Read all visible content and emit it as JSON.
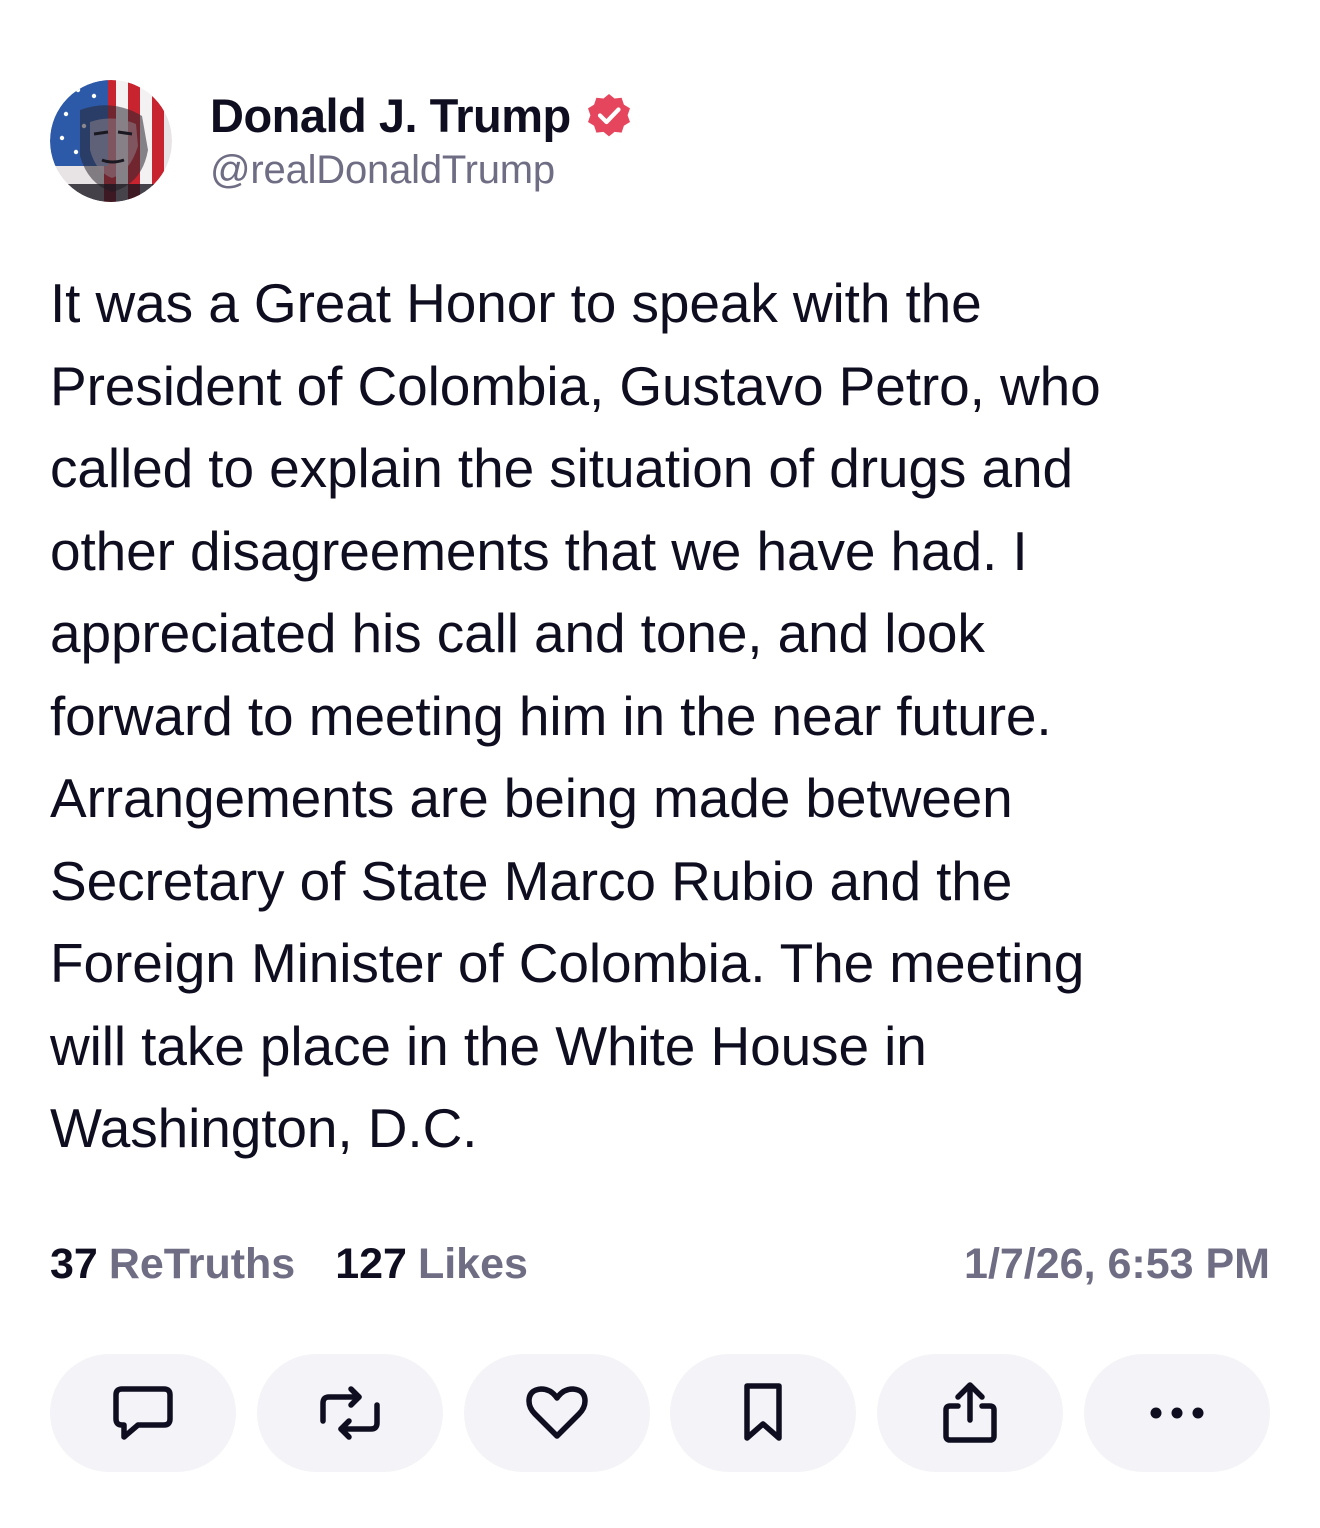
{
  "author": {
    "display_name": "Donald J. Trump",
    "handle": "@realDonaldTrump",
    "verified": true,
    "verified_color": "#e5465e"
  },
  "post": {
    "lines": [
      "It was a Great Honor to speak with the",
      "President of Colombia, Gustavo Petro, who",
      "called to explain the situation of drugs and",
      "other disagreements that we have had. I",
      "appreciated his call and tone, and look",
      "forward to meeting him in the near future.",
      "Arrangements are being made between",
      "Secretary of State Marco Rubio and the",
      "Foreign Minister of Colombia. The meeting",
      "will take place in the White House in",
      "Washington, D.C."
    ]
  },
  "stats": {
    "retruths_count": "37",
    "retruths_label": "ReTruths",
    "likes_count": "127",
    "likes_label": "Likes",
    "timestamp": "1/7/26, 6:53 PM"
  },
  "actions": [
    {
      "name": "reply-button",
      "icon": "comment-icon"
    },
    {
      "name": "retruth-button",
      "icon": "repost-icon"
    },
    {
      "name": "like-button",
      "icon": "heart-icon"
    },
    {
      "name": "bookmark-button",
      "icon": "bookmark-icon"
    },
    {
      "name": "share-button",
      "icon": "share-icon"
    },
    {
      "name": "more-button",
      "icon": "more-icon"
    }
  ],
  "colors": {
    "text": "#0f0e20",
    "muted": "#6f6d84",
    "button_bg": "#f4f4f8"
  }
}
